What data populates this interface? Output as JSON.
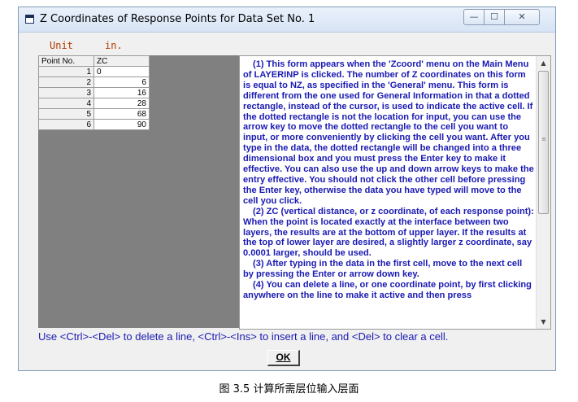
{
  "window": {
    "title": "Z Coordinates of Response Points for Data Set No. 1",
    "controls": {
      "minimize": "—",
      "maximize": "☐",
      "close": "✕"
    }
  },
  "unit": {
    "label": "Unit",
    "value": "in."
  },
  "grid": {
    "headers": [
      "Point No.",
      "ZC"
    ],
    "rows": [
      {
        "point": "1",
        "zc": "0"
      },
      {
        "point": "2",
        "zc": "6"
      },
      {
        "point": "3",
        "zc": "16"
      },
      {
        "point": "4",
        "zc": "28"
      },
      {
        "point": "5",
        "zc": "68"
      },
      {
        "point": "6",
        "zc": "90"
      }
    ]
  },
  "help": {
    "paragraphs": [
      "(1)  This form appears when the 'Zcoord' menu on the Main Menu of LAYERINP is clicked.  The number of Z coordinates on this form is equal to NZ, as specified in the 'General' menu.  This form is different from the one used for General Information in that a dotted rectangle, instead of the cursor, is used to indicate the active cell.  If the dotted rectangle is not the location for input, you can use the arrow key to move the dotted rectangle to the cell you want to input, or more conveniently by clicking the cell you want.  After you type in the data, the dotted rectangle will be changed into a three dimensional box and you must press the Enter key to make it effective.  You can also use the up and down arrow keys to make the entry effective.  You should not click the other cell before pressing the Enter key, otherwise the data you have typed will move to the cell you click.",
      "(2)  ZC (vertical distance, or z coordinate, of each response point): When the point is located exactly at the interface between two layers, the results are at the bottom of upper layer.  If the results at the top of lower layer are desired, a slightly larger z coordinate, say 0.0001 larger, should be used.",
      "(3)  After typing in the data in the first cell, move to the next cell by pressing the Enter or arrow down key.",
      "(4)  You can delete a line, or one coordinate point, by first clicking anywhere on the line to make it active and then press"
    ]
  },
  "hint": "Use <Ctrl>-<Del> to delete a line, <Ctrl>-<Ins> to insert a line, and <Del> to clear a cell.",
  "ok_button": {
    "label": "OK"
  },
  "caption": "图 3.5 计算所需层位输入层面"
}
